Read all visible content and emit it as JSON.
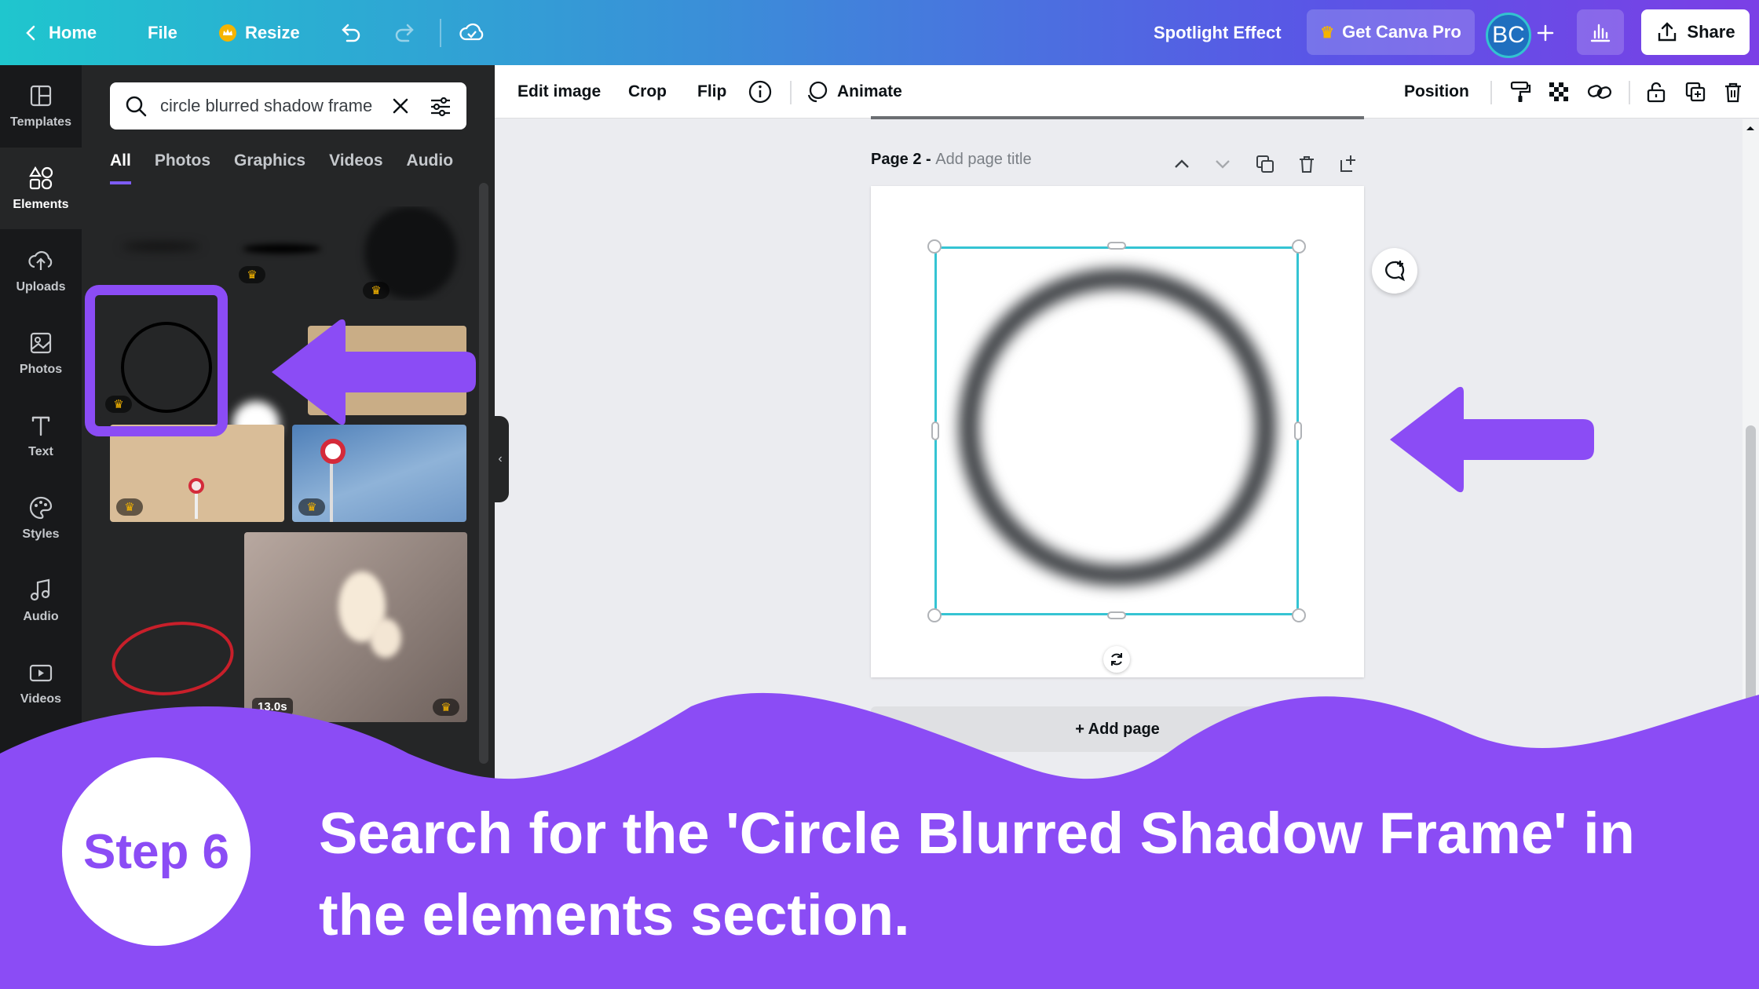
{
  "topbar": {
    "home": "Home",
    "file": "File",
    "resize": "Resize",
    "title": "Spotlight Effect",
    "get_pro": "Get Canva Pro",
    "avatar_initials": "BC",
    "share": "Share"
  },
  "rail": {
    "items": [
      {
        "label": "Templates",
        "icon": "templates-icon"
      },
      {
        "label": "Elements",
        "icon": "elements-icon"
      },
      {
        "label": "Uploads",
        "icon": "cloud-upload-icon"
      },
      {
        "label": "Photos",
        "icon": "image-icon"
      },
      {
        "label": "Text",
        "icon": "text-icon"
      },
      {
        "label": "Styles",
        "icon": "palette-icon"
      },
      {
        "label": "Audio",
        "icon": "music-note-icon"
      },
      {
        "label": "Videos",
        "icon": "video-icon"
      }
    ]
  },
  "panel": {
    "search_value": "circle blurred shadow frame",
    "tabs": [
      "All",
      "Photos",
      "Graphics",
      "Videos",
      "Audio"
    ],
    "video_duration": "13.0s"
  },
  "context_toolbar": {
    "edit_image": "Edit image",
    "crop": "Crop",
    "flip": "Flip",
    "animate": "Animate",
    "position": "Position"
  },
  "canvas": {
    "page_label": "Page 2 - ",
    "page_title_placeholder": "Add page title",
    "add_page": "+ Add page"
  },
  "tutorial": {
    "step": "Step 6",
    "instruction": "Search for the 'Circle Blurred Shadow Frame' in the elements section."
  },
  "colors": {
    "accent_purple": "#8b4cf5",
    "selection_cyan": "#35c4d3"
  }
}
